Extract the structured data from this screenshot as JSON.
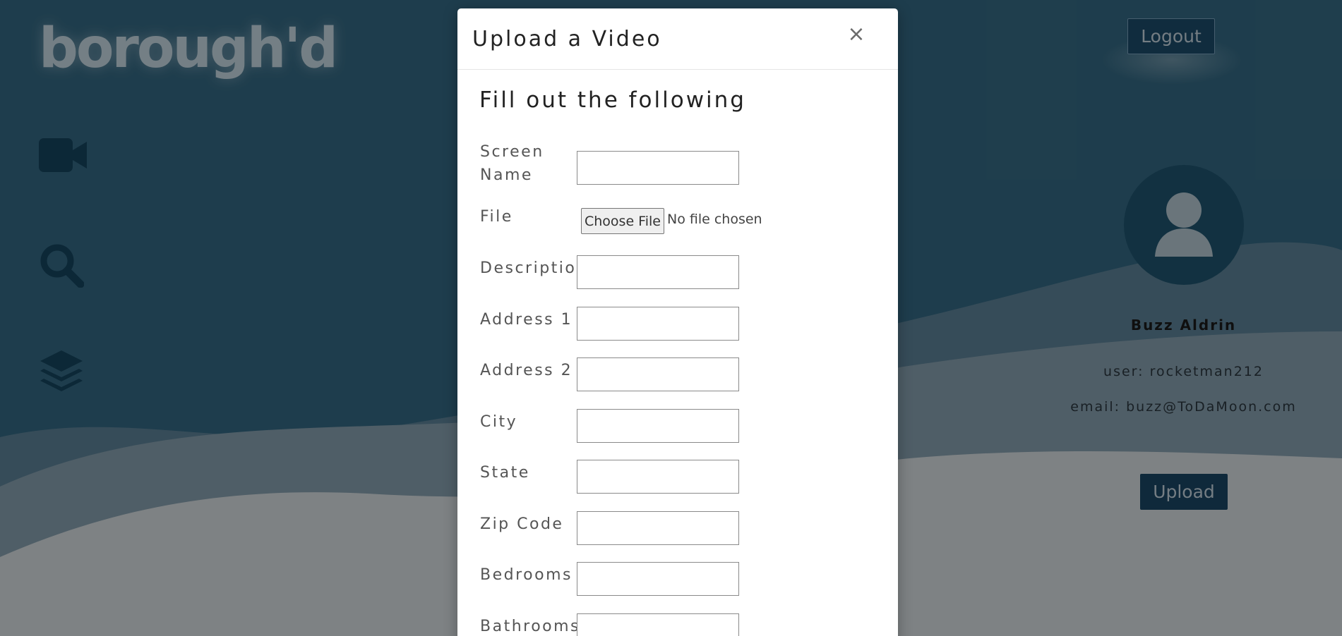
{
  "brand": {
    "logo_text": "borough'd"
  },
  "sidebar": {
    "icons": [
      "video-camera-icon",
      "search-icon",
      "layers-icon"
    ]
  },
  "header": {
    "logout_label": "Logout"
  },
  "profile": {
    "name": "Buzz Aldrin",
    "user_line": "user: rocketman212",
    "email_line": "email: buzz@ToDaMoon.com",
    "upload_label": "Upload"
  },
  "modal": {
    "title": "Upload a Video",
    "close_glyph": "×",
    "form_heading": "Fill out the following",
    "fields": {
      "screen_name": {
        "label": "Screen Name",
        "value": ""
      },
      "file": {
        "label": "File",
        "button": "Choose File",
        "status": "No file chosen"
      },
      "description": {
        "label": "Description",
        "value": ""
      },
      "address1": {
        "label": "Address 1",
        "value": ""
      },
      "address2": {
        "label": "Address 2",
        "value": ""
      },
      "city": {
        "label": "City",
        "value": ""
      },
      "state": {
        "label": "State",
        "value": ""
      },
      "zip": {
        "label": "Zip Code",
        "value": ""
      },
      "bedrooms": {
        "label": "Bedrooms",
        "value": ""
      },
      "bathrooms": {
        "label": "Bathrooms",
        "value": ""
      }
    }
  },
  "colors": {
    "background_top": "#356a85",
    "wave_mid": "#7f9aab",
    "wave_low": "#d7dfe3",
    "button_dark": "#1a4766",
    "modal_bg": "#ffffff"
  }
}
